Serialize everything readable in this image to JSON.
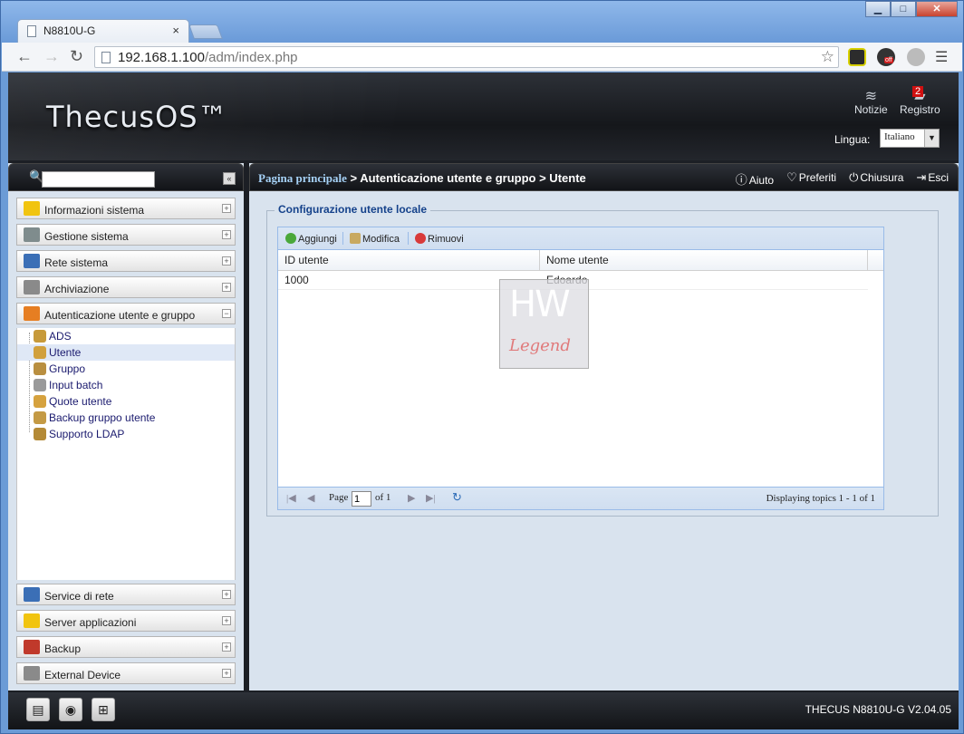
{
  "browser": {
    "tab_title": "N8810U-G",
    "tab_close": "×",
    "url_host": "192.168.1.100",
    "url_path": "/adm/index.php",
    "ext_badge": "off"
  },
  "header": {
    "logo": "ThecusOS™",
    "notizie": "Notizie",
    "registro": "Registro",
    "registro_badge": "2",
    "lingua_label": "Lingua:",
    "lingua_value": "Italiano"
  },
  "sidebar": {
    "groups_top": [
      {
        "label": "Informazioni sistema",
        "icon": "info-icon",
        "color": "#f1c40f"
      },
      {
        "label": "Gestione sistema",
        "icon": "tools-icon",
        "color": "#7f8c8d"
      },
      {
        "label": "Rete sistema",
        "icon": "network-icon",
        "color": "#3b6fb6"
      },
      {
        "label": "Archiviazione",
        "icon": "storage-icon",
        "color": "#8a8a8a"
      },
      {
        "label": "Autenticazione utente e gruppo",
        "icon": "users-icon",
        "color": "#e67e22",
        "expanded": true
      }
    ],
    "tree": [
      {
        "label": "ADS"
      },
      {
        "label": "Utente",
        "selected": true
      },
      {
        "label": "Gruppo"
      },
      {
        "label": "Input batch"
      },
      {
        "label": "Quote utente"
      },
      {
        "label": "Backup gruppo utente"
      },
      {
        "label": "Supporto LDAP"
      }
    ],
    "groups_bottom": [
      {
        "label": "Service di rete",
        "icon": "service-icon",
        "color": "#3b6fb6"
      },
      {
        "label": "Server applicazioni",
        "icon": "folder-icon",
        "color": "#f1c40f"
      },
      {
        "label": "Backup",
        "icon": "backup-icon",
        "color": "#c0392b"
      },
      {
        "label": "External Device",
        "icon": "device-icon",
        "color": "#8a8a8a"
      }
    ]
  },
  "breadcrumb": {
    "home": "Pagina principale",
    "path": " > Autenticazione utente e gruppo > Utente"
  },
  "tools": {
    "aiuto": "Aiuto",
    "preferiti": "Preferiti",
    "chiusura": "Chiusura",
    "esci": "Esci"
  },
  "panel": {
    "legend": "Configurazione utente locale",
    "add": "Aggiungi",
    "edit": "Modifica",
    "remove": "Rimuovi",
    "columns": [
      "ID utente",
      "Nome utente"
    ],
    "rows": [
      [
        "1000",
        "Edoardo"
      ]
    ],
    "page_label": "Page",
    "page_value": "1",
    "page_of": "of 1",
    "display": "Displaying topics 1 - 1 of 1"
  },
  "watermark": {
    "hw": "HW",
    "legend": "Legend"
  },
  "footer": {
    "version": "THECUS N8810U-G V2.04.05"
  }
}
